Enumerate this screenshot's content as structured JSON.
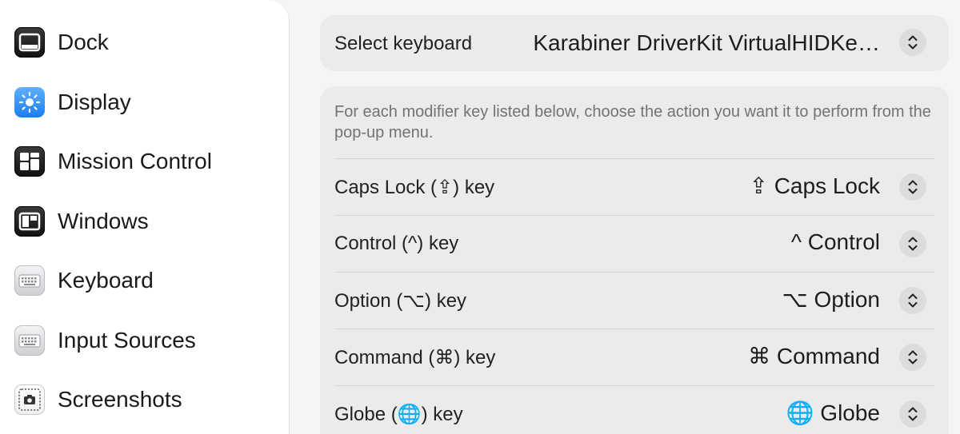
{
  "sidebar": {
    "items": [
      {
        "label": "Dock",
        "icon": "dock-icon"
      },
      {
        "label": "Display",
        "icon": "display-icon"
      },
      {
        "label": "Mission Control",
        "icon": "mission-control-icon"
      },
      {
        "label": "Windows",
        "icon": "windows-icon"
      },
      {
        "label": "Keyboard",
        "icon": "keyboard-icon"
      },
      {
        "label": "Input Sources",
        "icon": "input-sources-icon"
      },
      {
        "label": "Screenshots",
        "icon": "screenshots-icon"
      }
    ]
  },
  "keyboard_select": {
    "label": "Select keyboard",
    "value": "Karabiner DriverKit VirtualHIDKe…"
  },
  "modifiers": {
    "description": "For each modifier key listed below, choose the action you want it to perform from the pop-up menu.",
    "rows": [
      {
        "label": "Caps Lock (⇪) key",
        "value": "⇪ Caps Lock"
      },
      {
        "label": "Control (^) key",
        "value": "^ Control"
      },
      {
        "label": "Option (⌥) key",
        "value": "⌥ Option"
      },
      {
        "label": "Command (⌘) key",
        "value": "⌘ Command"
      },
      {
        "label": "Globe (🌐) key",
        "value": "🌐 Globe"
      }
    ]
  },
  "colors": {
    "background": "#f5f5f5",
    "card": "#ebebeb",
    "stepper": "#dcdcdc",
    "accent_blue": "#1a7ef0"
  }
}
